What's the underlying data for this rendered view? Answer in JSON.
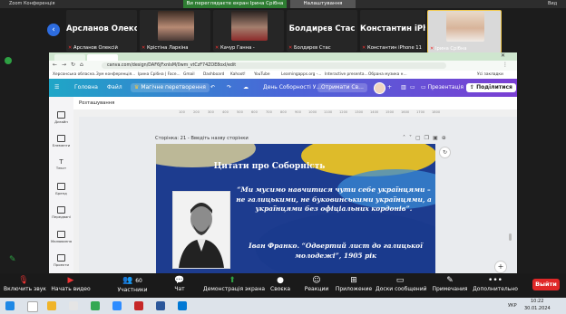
{
  "zoom": {
    "app_title": "Zoom Конференція",
    "share_banner": "Ви переглядаєте екран Ірина Срібна",
    "view_options": "Налаштування перегляду",
    "view_label": "Вид",
    "participants": [
      {
        "name": "Арсланов Олекс...",
        "label": "Арсланов Олексій"
      },
      {
        "name": "",
        "label": "Крістіна Ларкіна"
      },
      {
        "name": "",
        "label": "Качур Ганна -"
      },
      {
        "name": "Болдирєв Стас",
        "label": "Болдирєв Стас"
      },
      {
        "name": "Константин iPh...",
        "label": "Константин iPhone 11"
      },
      {
        "name": "",
        "label": "Ірина Срібна"
      }
    ],
    "controls": {
      "mute": "Включить звук",
      "video": "Начать видео",
      "participants": "Участники",
      "participants_count": "60",
      "chat": "Чат",
      "share": "Демонстрація экрана",
      "reactions": "Своєка",
      "reactions2": "Реакции",
      "apps": "Приложение",
      "whiteboard": "Доски сообщений",
      "notes": "Примечания",
      "more": "Дополнительно",
      "end": "Выйти"
    }
  },
  "browser": {
    "url": "canva.com/design/DAF6jFxnIsM/0wm_vtCzF74ZOE8oxI/edit",
    "bookmarks": [
      "Херсонська обласна...",
      "Зум конференція...",
      "Ірина Срібна | Face...",
      "Gmail",
      "Dashboard",
      "Kahoot!",
      "YouTube",
      "Learningapps.org -...",
      "Interactive presenta...",
      "Обрана музика н...",
      "Усі закладки"
    ]
  },
  "canva": {
    "home": "Головна",
    "file": "Файл",
    "magic": "Магічне перетворення",
    "doc_title": "День Соборності У...",
    "get_canva": "Отримати Св...",
    "present": "Презентація",
    "share": "Поділитися",
    "toolbar_label": "Розташування",
    "rail": [
      "Дизайн",
      "Елементи",
      "Текст",
      "Бренд",
      "Передвані",
      "Малювання",
      "Проекти"
    ],
    "ruler": [
      "100",
      "200",
      "300",
      "400",
      "500",
      "600",
      "700",
      "800",
      "900",
      "1000",
      "1100",
      "1200",
      "1300",
      "1400",
      "1500",
      "1600",
      "1700",
      "1800"
    ],
    "page_label": "Сторінка: 21 - Введіть назву сторінки"
  },
  "slide": {
    "title": "Цитати про Соборність",
    "quote": "“Ми мусимо навчитися чути себе українцями – не галицькими, не буковинськими українцями, а українцями без офіціальних кордонів”.",
    "attribution": "Іван Франко. “Одвертий лист до галицької молодежі”, 1905 рік"
  },
  "taskbar": {
    "lang": "УКР",
    "time": "10:22",
    "date": "30.01.2024"
  }
}
